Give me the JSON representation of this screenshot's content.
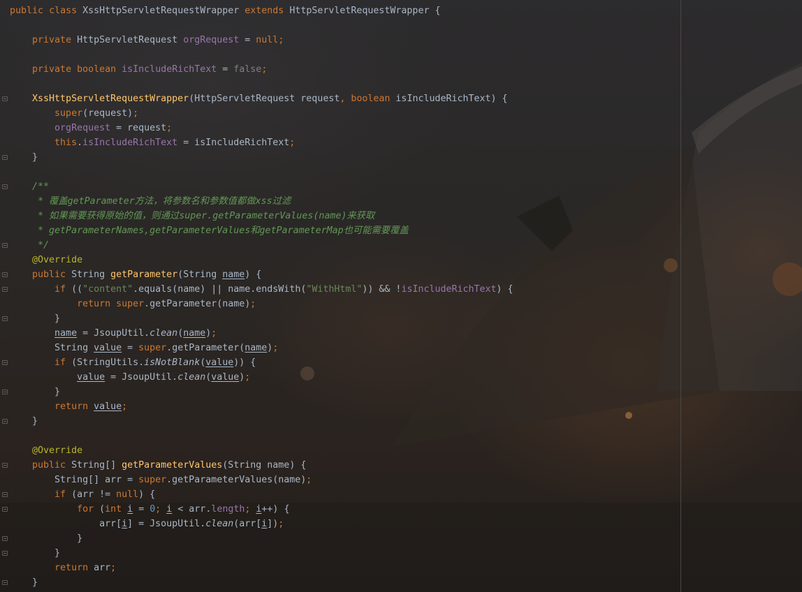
{
  "editor": {
    "theme_colors": {
      "keyword": "#cc7832",
      "field": "#9876aa",
      "method": "#ffc66d",
      "string": "#6a8759",
      "number": "#6897bb",
      "annotation": "#bbb529",
      "comment": "#629755",
      "text": "#a9b7c6"
    },
    "lines": [
      [
        {
          "t": "public",
          "c": "kw"
        },
        {
          "t": " "
        },
        {
          "t": "class",
          "c": "kw"
        },
        {
          "t": " XssHttpServletRequestWrapper "
        },
        {
          "t": "extends",
          "c": "kw"
        },
        {
          "t": " HttpServletRequestWrapper {"
        }
      ],
      [],
      [
        {
          "t": "    "
        },
        {
          "t": "private",
          "c": "kw"
        },
        {
          "t": " HttpServletRequest "
        },
        {
          "t": "orgRequest",
          "c": "fld"
        },
        {
          "t": " = "
        },
        {
          "t": "null",
          "c": "nul"
        },
        {
          "t": ";",
          "c": "pn"
        }
      ],
      [],
      [
        {
          "t": "    "
        },
        {
          "t": "private",
          "c": "kw"
        },
        {
          "t": " "
        },
        {
          "t": "boolean",
          "c": "kw"
        },
        {
          "t": " "
        },
        {
          "t": "isIncludeRichText",
          "c": "fld"
        },
        {
          "t": " = "
        },
        {
          "t": "false",
          "c": "fls"
        },
        {
          "t": ";",
          "c": "pn"
        }
      ],
      [],
      [
        {
          "t": "    "
        },
        {
          "t": "XssHttpServletRequestWrapper",
          "c": "fn"
        },
        {
          "t": "(HttpServletRequest request"
        },
        {
          "t": ",",
          "c": "pn"
        },
        {
          "t": " "
        },
        {
          "t": "boolean",
          "c": "kw"
        },
        {
          "t": " isIncludeRichText) {"
        }
      ],
      [
        {
          "t": "        "
        },
        {
          "t": "super",
          "c": "kw"
        },
        {
          "t": "(request)"
        },
        {
          "t": ";",
          "c": "pn"
        }
      ],
      [
        {
          "t": "        "
        },
        {
          "t": "orgRequest",
          "c": "fld"
        },
        {
          "t": " = request"
        },
        {
          "t": ";",
          "c": "pn"
        }
      ],
      [
        {
          "t": "        "
        },
        {
          "t": "this",
          "c": "kw"
        },
        {
          "t": "."
        },
        {
          "t": "isIncludeRichText",
          "c": "fld"
        },
        {
          "t": " = isIncludeRichText"
        },
        {
          "t": ";",
          "c": "pn"
        }
      ],
      [
        {
          "t": "    }"
        }
      ],
      [],
      [
        {
          "t": "    "
        },
        {
          "t": "/**",
          "c": "cmt"
        }
      ],
      [
        {
          "t": "     "
        },
        {
          "t": "* 覆盖getParameter方法，将参数名和参数值都做xss过滤",
          "c": "cmt"
        }
      ],
      [
        {
          "t": "     "
        },
        {
          "t": "* 如果需要获得原始的值，则通过super.getParameterValues(name)来获取",
          "c": "cmt"
        }
      ],
      [
        {
          "t": "     "
        },
        {
          "t": "* getParameterNames,getParameterValues和getParameterMap也可能需要覆盖",
          "c": "cmt"
        }
      ],
      [
        {
          "t": "     "
        },
        {
          "t": "*/",
          "c": "cmt"
        }
      ],
      [
        {
          "t": "    "
        },
        {
          "t": "@Override",
          "c": "ann"
        }
      ],
      [
        {
          "t": "    "
        },
        {
          "t": "public",
          "c": "kw"
        },
        {
          "t": " String "
        },
        {
          "t": "getParameter",
          "c": "fn"
        },
        {
          "t": "(String "
        },
        {
          "t": "name",
          "c": "ul"
        },
        {
          "t": ") {"
        }
      ],
      [
        {
          "t": "        "
        },
        {
          "t": "if",
          "c": "kw"
        },
        {
          "t": " (("
        },
        {
          "t": "\"content\"",
          "c": "str"
        },
        {
          "t": ".equals(name) || name.endsWith("
        },
        {
          "t": "\"WithHtml\"",
          "c": "str"
        },
        {
          "t": ")) && !"
        },
        {
          "t": "isIncludeRichText",
          "c": "fld"
        },
        {
          "t": ") {"
        }
      ],
      [
        {
          "t": "            "
        },
        {
          "t": "return",
          "c": "kw"
        },
        {
          "t": " "
        },
        {
          "t": "super",
          "c": "kw"
        },
        {
          "t": ".getParameter(name)"
        },
        {
          "t": ";",
          "c": "pn"
        }
      ],
      [
        {
          "t": "        }"
        }
      ],
      [
        {
          "t": "        "
        },
        {
          "t": "name",
          "c": "ul"
        },
        {
          "t": " = JsoupUtil."
        },
        {
          "t": "clean",
          "c": "ital"
        },
        {
          "t": "("
        },
        {
          "t": "name",
          "c": "ul"
        },
        {
          "t": ")"
        },
        {
          "t": ";",
          "c": "pn"
        }
      ],
      [
        {
          "t": "        String "
        },
        {
          "t": "value",
          "c": "ul"
        },
        {
          "t": " = "
        },
        {
          "t": "super",
          "c": "kw"
        },
        {
          "t": ".getParameter("
        },
        {
          "t": "name",
          "c": "ul"
        },
        {
          "t": ")"
        },
        {
          "t": ";",
          "c": "pn"
        }
      ],
      [
        {
          "t": "        "
        },
        {
          "t": "if",
          "c": "kw"
        },
        {
          "t": " (StringUtils."
        },
        {
          "t": "isNotBlank",
          "c": "ital"
        },
        {
          "t": "("
        },
        {
          "t": "value",
          "c": "ul"
        },
        {
          "t": ")) {"
        }
      ],
      [
        {
          "t": "            "
        },
        {
          "t": "value",
          "c": "ul"
        },
        {
          "t": " = JsoupUtil."
        },
        {
          "t": "clean",
          "c": "ital"
        },
        {
          "t": "("
        },
        {
          "t": "value",
          "c": "ul"
        },
        {
          "t": ")"
        },
        {
          "t": ";",
          "c": "pn"
        }
      ],
      [
        {
          "t": "        }"
        }
      ],
      [
        {
          "t": "        "
        },
        {
          "t": "return",
          "c": "kw"
        },
        {
          "t": " "
        },
        {
          "t": "value",
          "c": "ul"
        },
        {
          "t": ";",
          "c": "pn"
        }
      ],
      [
        {
          "t": "    }"
        }
      ],
      [],
      [
        {
          "t": "    "
        },
        {
          "t": "@Override",
          "c": "ann"
        }
      ],
      [
        {
          "t": "    "
        },
        {
          "t": "public",
          "c": "kw"
        },
        {
          "t": " String[] "
        },
        {
          "t": "getParameterValues",
          "c": "fn"
        },
        {
          "t": "(String name) {"
        }
      ],
      [
        {
          "t": "        String[] arr = "
        },
        {
          "t": "super",
          "c": "kw"
        },
        {
          "t": ".getParameterValues(name)"
        },
        {
          "t": ";",
          "c": "pn"
        }
      ],
      [
        {
          "t": "        "
        },
        {
          "t": "if",
          "c": "kw"
        },
        {
          "t": " (arr != "
        },
        {
          "t": "null",
          "c": "nul"
        },
        {
          "t": ") {"
        }
      ],
      [
        {
          "t": "            "
        },
        {
          "t": "for",
          "c": "kw"
        },
        {
          "t": " ("
        },
        {
          "t": "int",
          "c": "kw"
        },
        {
          "t": " "
        },
        {
          "t": "i",
          "c": "ul"
        },
        {
          "t": " = "
        },
        {
          "t": "0",
          "c": "num"
        },
        {
          "t": ";",
          "c": "pn"
        },
        {
          "t": " "
        },
        {
          "t": "i",
          "c": "ul"
        },
        {
          "t": " < arr."
        },
        {
          "t": "length",
          "c": "fld"
        },
        {
          "t": ";",
          "c": "pn"
        },
        {
          "t": " "
        },
        {
          "t": "i",
          "c": "ul"
        },
        {
          "t": "++) {"
        }
      ],
      [
        {
          "t": "                arr["
        },
        {
          "t": "i",
          "c": "ul"
        },
        {
          "t": "] = JsoupUtil."
        },
        {
          "t": "clean",
          "c": "ital"
        },
        {
          "t": "(arr["
        },
        {
          "t": "i",
          "c": "ul"
        },
        {
          "t": "])"
        },
        {
          "t": ";",
          "c": "pn"
        }
      ],
      [
        {
          "t": "            }"
        }
      ],
      [
        {
          "t": "        }"
        }
      ],
      [
        {
          "t": "        "
        },
        {
          "t": "return",
          "c": "kw"
        },
        {
          "t": " arr"
        },
        {
          "t": ";",
          "c": "pn"
        }
      ],
      [
        {
          "t": "    }"
        }
      ]
    ],
    "fold_markers": [
      6,
      10,
      12,
      16,
      18,
      19,
      21,
      24,
      26,
      28,
      31,
      33,
      34,
      36,
      37,
      39
    ]
  }
}
